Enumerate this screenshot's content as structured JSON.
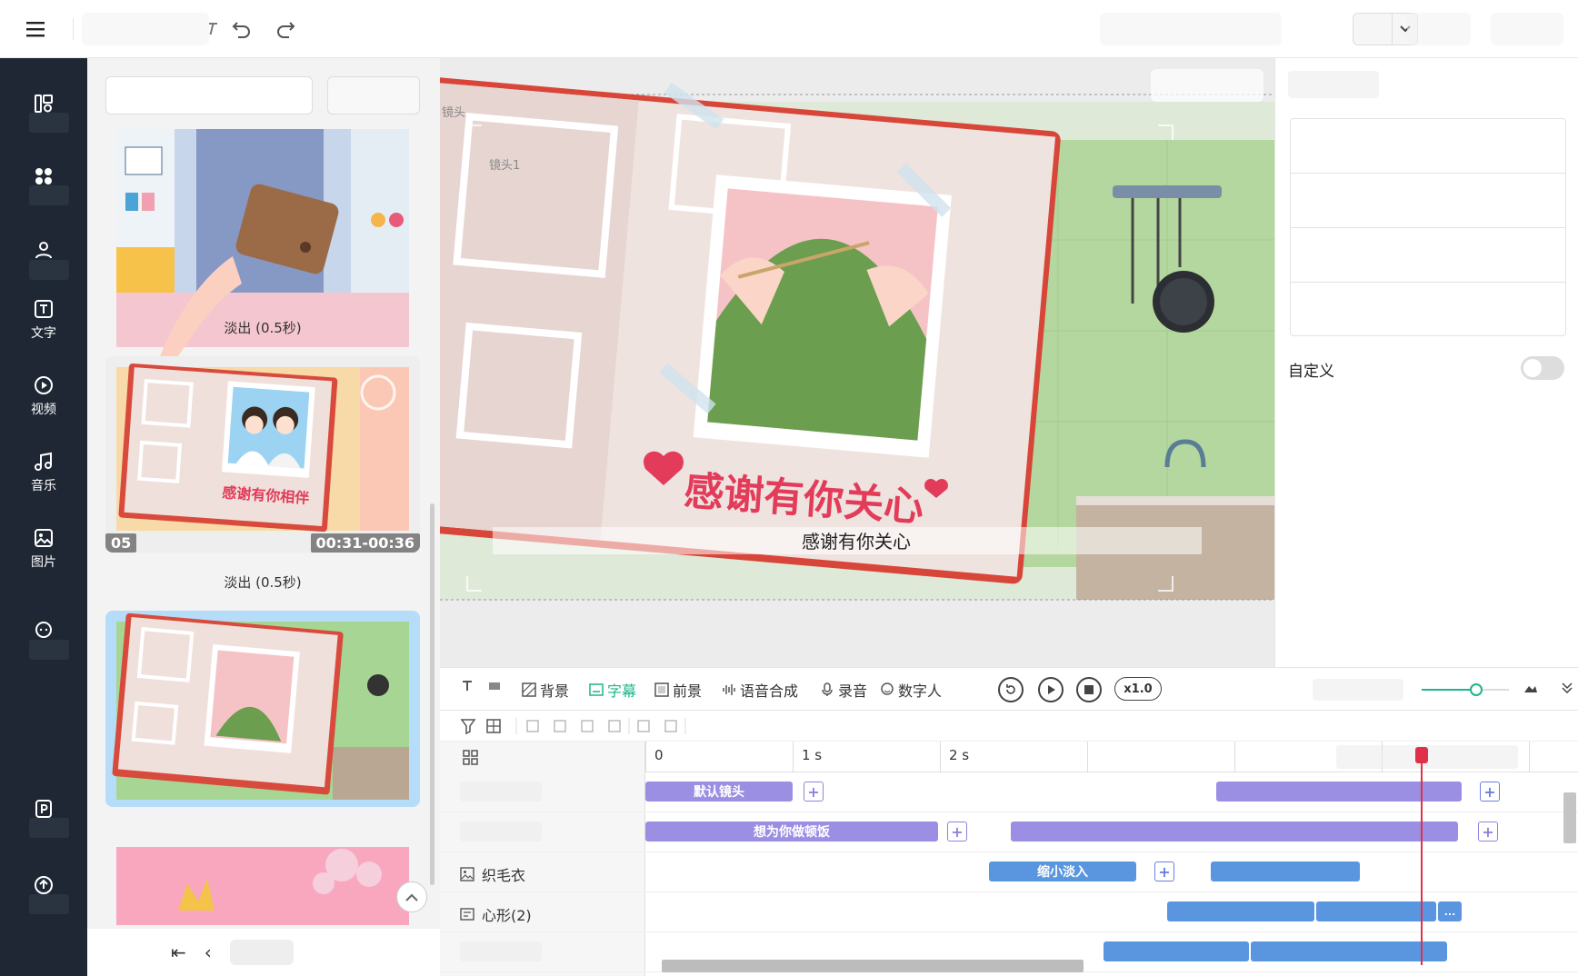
{
  "topbar": {
    "menu_icon": "hamburger-icon",
    "undo_icon": "undo-icon",
    "redo_icon": "redo-icon",
    "dropdown_icon": "chevron-down-icon"
  },
  "leftnav": {
    "items": [
      {
        "icon": "template-icon",
        "label": ""
      },
      {
        "icon": "element-icon",
        "label": ""
      },
      {
        "icon": "character-icon",
        "label": ""
      },
      {
        "icon": "text-icon",
        "label": "文字"
      },
      {
        "icon": "video-icon",
        "label": "视频"
      },
      {
        "icon": "music-icon",
        "label": "音乐"
      },
      {
        "icon": "image-icon",
        "label": "图片"
      },
      {
        "icon": "chat-icon",
        "label": ""
      },
      {
        "icon": "ppt-icon",
        "label": ""
      },
      {
        "icon": "upload-icon",
        "label": ""
      }
    ]
  },
  "scenes": {
    "transition1": "淡出 (0.5秒)",
    "transition2": "淡出 (0.5秒)",
    "scene2_number": "05",
    "scene2_time": "00:31-00:36",
    "scene2_caption": "感谢有你相伴"
  },
  "canvas": {
    "lens_label": "镜头1",
    "lens_label_left": "镜头",
    "title_art": "感谢有你关心",
    "subtitle": "感谢有你关心"
  },
  "rightpanel": {
    "custom_label": "自定义",
    "custom_enabled": false
  },
  "timeline_toolbar": {
    "background": "背景",
    "subtitle": "字幕",
    "foreground": "前景",
    "tts": "语音合成",
    "record": "录音",
    "avatar": "数字人",
    "speed": "x1.0",
    "zoom_level": 0.62
  },
  "timeline": {
    "ruler": [
      "0",
      "1 s",
      "2 s"
    ],
    "tracks": [
      {
        "label": "",
        "clips": [
          "默认镜头",
          ""
        ]
      },
      {
        "label": "",
        "clips": [
          "想为你做顿饭",
          ""
        ]
      },
      {
        "label": "织毛衣",
        "clips": [
          "缩小淡入",
          ""
        ]
      },
      {
        "label": "心形(2)",
        "clips": [
          "",
          "",
          "..."
        ]
      },
      {
        "label": "",
        "clips": [
          "",
          ""
        ]
      }
    ]
  },
  "colors": {
    "sidebar": "#1e2733",
    "accent": "#1db48a",
    "clip_purple": "#9b8fe3",
    "clip_blue": "#5a95e0",
    "playhead": "#e0314b",
    "title_red": "#e23c5a"
  }
}
